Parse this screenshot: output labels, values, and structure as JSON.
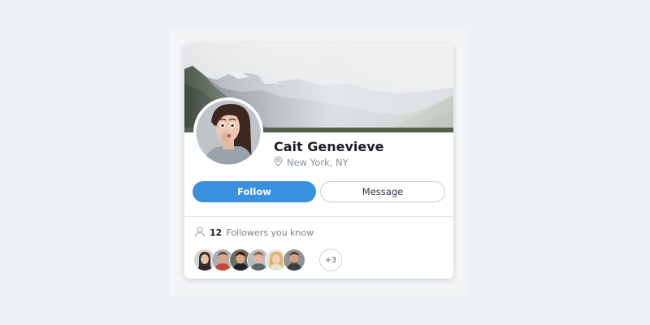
{
  "profile": {
    "name": "Cait Genevieve",
    "location": "New York, NY"
  },
  "actions": {
    "follow_label": "Follow",
    "message_label": "Message"
  },
  "followers": {
    "count": "12",
    "label": "Followers you know",
    "more_label": "+3",
    "avatars": [
      "avatar-1",
      "avatar-2",
      "avatar-3",
      "avatar-4",
      "avatar-5",
      "avatar-6"
    ]
  },
  "icons": {
    "location": "map-pin-icon",
    "followers": "user-icon"
  },
  "colors": {
    "accent": "#3a8fde",
    "text_primary": "#1c1f24",
    "text_muted": "#8a929c",
    "card_bg": "#ffffff",
    "page_bg": "#eef1f4"
  }
}
